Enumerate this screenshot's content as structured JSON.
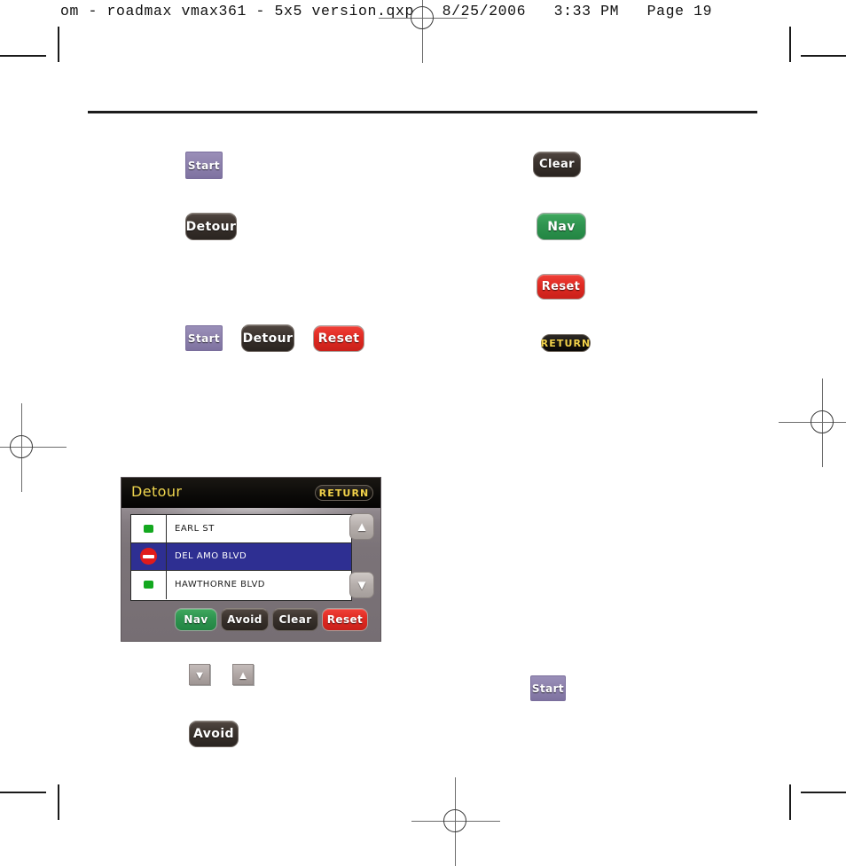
{
  "print_header": {
    "text": "om - roadmax vmax361 - 5x5 version.qxp   8/25/2006   3:33 PM   Page 19"
  },
  "colors": {
    "start_purple": "#8e82ad",
    "dark_button": "#3b332e",
    "nav_green": "#2f9450",
    "reset_red": "#e02a22",
    "return_yellow": "#f2d24a",
    "selected_row_blue": "#2e2f92",
    "no_entry_red": "#e01b1b",
    "status_green": "#13a81f",
    "device_bezel": "#7b7378"
  },
  "figures": {
    "left_column": [
      {
        "label": "Start",
        "style": "start"
      },
      {
        "label": "Detour",
        "style": "dark"
      }
    ],
    "right_column": [
      {
        "label": "Clear",
        "style": "dark"
      },
      {
        "label": "Nav",
        "style": "green"
      },
      {
        "label": "Reset",
        "style": "red"
      },
      {
        "label": "RETURN",
        "style": "return"
      }
    ],
    "middle_row": [
      {
        "label": "Start",
        "style": "start"
      },
      {
        "label": "Detour",
        "style": "dark"
      },
      {
        "label": "Reset",
        "style": "red"
      }
    ],
    "bottom": {
      "arrow_down": "▼",
      "arrow_up": "▲",
      "avoid": {
        "label": "Avoid",
        "style": "dark"
      },
      "start": {
        "label": "Start",
        "style": "start"
      }
    }
  },
  "device_screen": {
    "title": "Detour",
    "return_label": "RETURN",
    "scroll_up_glyph": "▲",
    "scroll_down_glyph": "▼",
    "list": [
      {
        "name": "EARL ST",
        "icon": "green-dot",
        "selected": false
      },
      {
        "name": "DEL AMO BLVD",
        "icon": "no-entry",
        "selected": true
      },
      {
        "name": "HAWTHORNE BLVD",
        "icon": "green-dot",
        "selected": false
      }
    ],
    "actions": [
      {
        "label": "Nav",
        "style": "green"
      },
      {
        "label": "Avoid",
        "style": "dark"
      },
      {
        "label": "Clear",
        "style": "dark"
      },
      {
        "label": "Reset",
        "style": "red"
      }
    ]
  }
}
